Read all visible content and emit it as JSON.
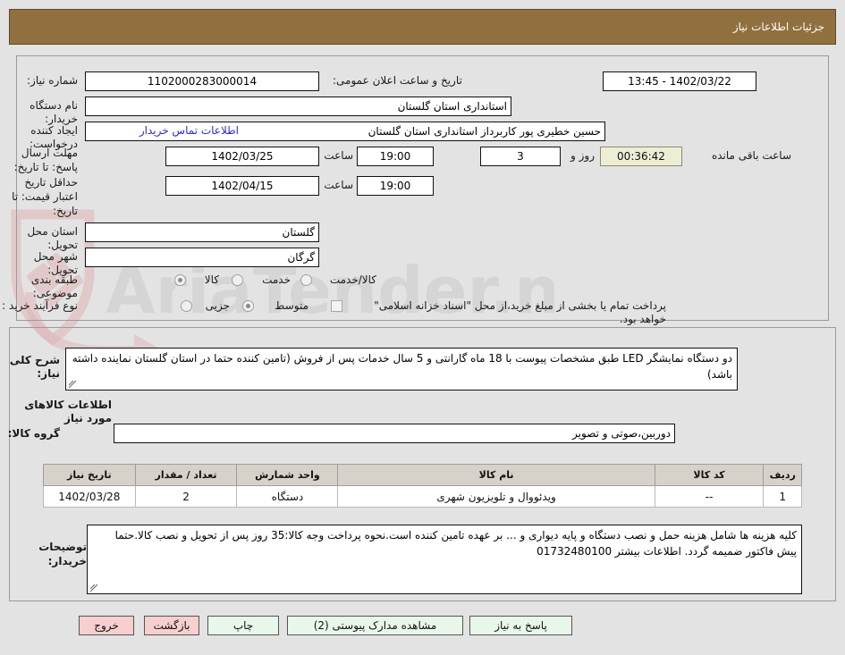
{
  "header": {
    "title": "جزئیات اطلاعات نیاز"
  },
  "watermark": {
    "text": "AriaTender.net",
    "logo_icon": "shield-gavel-icon",
    "color": "#d8d8d8",
    "logo_color": "#e2b9bb"
  },
  "form": {
    "need_number": {
      "label": "شماره نیاز:",
      "value": "1102000283000014"
    },
    "public_announcement": {
      "label": "تاریخ و ساعت اعلان عمومی:",
      "value": "1402/03/22 - 13:45"
    },
    "buyer_org": {
      "label": "نام دستگاه خریدار:",
      "value": "استانداری استان گلستان"
    },
    "requester": {
      "label": "ایجاد کننده درخواست:",
      "value": "حسین خطیری پور کاربرداز استانداری استان گلستان",
      "contact_link": "اطلاعات تماس خریدار"
    },
    "response_deadline": {
      "label": "مهلت ارسال پاسخ: تا تاریخ:",
      "date": "1402/03/25",
      "time_label": "ساعت",
      "time": "19:00",
      "days_value": "3",
      "days_label": "روز و",
      "countdown": "00:36:42",
      "countdown_suffix": "ساعت باقی مانده"
    },
    "price_validity": {
      "label": "حداقل تاریخ اعتبار قیمت: تا تاریخ:",
      "date": "1402/04/15",
      "time_label": "ساعت",
      "time": "19:00"
    },
    "delivery_province": {
      "label": "استان محل تحویل:",
      "value": "گلستان"
    },
    "delivery_city": {
      "label": "شهر محل تحویل:",
      "value": "گرگان"
    },
    "subject_category": {
      "label": "طبقه بندی موضوعی:",
      "options": [
        "کالا",
        "خدمت",
        "کالا/خدمت"
      ],
      "selected": "کالا"
    },
    "purchase_process": {
      "label": "نوع فرآیند خرید :",
      "options": [
        "جزیی",
        "متوسط"
      ],
      "selected": "متوسط"
    },
    "treasury_note": {
      "checked": false,
      "text": "پرداخت تمام یا بخشی از مبلغ خرید،از محل \"اسناد خزانه اسلامی\" خواهد بود."
    }
  },
  "need_description": {
    "label": "شرح کلی نیاز:",
    "value": "دو دستگاه نمایشگر LED طبق مشخصات پیوست با 18 ماه گارانتی و 5 سال خدمات پس از فروش (تامین کننده حتما در استان گلستان نماینده داشته باشد)"
  },
  "goods_section": {
    "heading": "اطلاعات کالاهای مورد نیاز",
    "group_label": "گروه کالا:",
    "group_value": "دوربین،صوتی و تصویر"
  },
  "goods_table": {
    "columns": [
      "ردیف",
      "کد کالا",
      "نام کالا",
      "واحد شمارش",
      "تعداد / مقدار",
      "تاریخ نیاز"
    ],
    "rows": [
      {
        "row_no": "1",
        "code": "--",
        "name": "ویدئووال و تلویزیون شهری",
        "unit": "دستگاه",
        "quantity": "2",
        "need_date": "1402/03/28"
      }
    ]
  },
  "buyer_notes": {
    "label": "توضیحات خریدار:",
    "value": "کلیه هزینه ها شامل هزینه حمل و نصب دستگاه  و پایه دیواری و ... بر عهده تامین کننده است.نحوه پرداخت وجه کالا:35 روز پس از تحویل و نصب کالا.حتما پیش فاکتور ضمیمه گردد. اطلاعات بیشتر 01732480100"
  },
  "buttons": [
    {
      "key": "respond",
      "label": "پاسخ به نیاز",
      "style": "green"
    },
    {
      "key": "attachments",
      "label": "مشاهده مدارک پیوستی (2)",
      "style": "green"
    },
    {
      "key": "print",
      "label": "چاپ",
      "style": "green"
    },
    {
      "key": "back",
      "label": "بازگشت",
      "style": "pink"
    },
    {
      "key": "exit",
      "label": "خروج",
      "style": "pink"
    }
  ]
}
